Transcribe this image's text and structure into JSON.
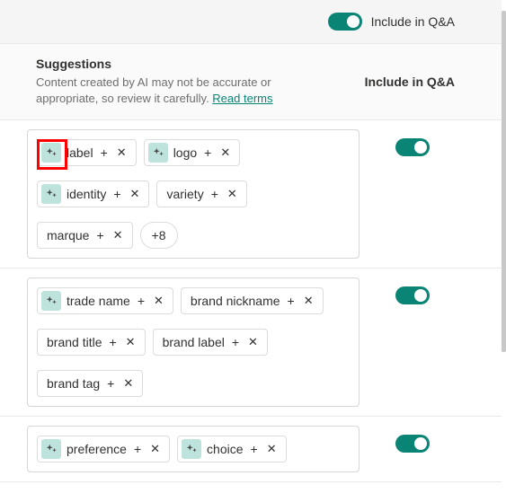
{
  "accent": "#0a8474",
  "topbar": {
    "toggle_label": "Include in Q&A",
    "toggle_on": true
  },
  "subheader": {
    "title": "Suggestions",
    "help_text_a": "Content created by AI may not be accurate or appropriate, so review it carefully. ",
    "link_text": "Read terms",
    "column_label": "Include in Q&A"
  },
  "groups": [
    {
      "toggle_on": true,
      "chips": [
        {
          "ai": true,
          "label": "label"
        },
        {
          "ai": true,
          "label": "logo"
        },
        {
          "ai": true,
          "label": "identity"
        },
        {
          "ai": false,
          "label": "variety"
        },
        {
          "ai": false,
          "label": "marque"
        }
      ],
      "more": "+8"
    },
    {
      "toggle_on": true,
      "chips": [
        {
          "ai": true,
          "label": "trade name"
        },
        {
          "ai": false,
          "label": "brand nickname"
        },
        {
          "ai": false,
          "label": "brand title"
        },
        {
          "ai": false,
          "label": "brand label"
        },
        {
          "ai": false,
          "label": "brand tag"
        }
      ],
      "more": null
    },
    {
      "toggle_on": true,
      "chips": [
        {
          "ai": true,
          "label": "preference"
        },
        {
          "ai": true,
          "label": "choice"
        }
      ],
      "more": null
    }
  ],
  "glyphs": {
    "plus": "+",
    "close": "✕"
  }
}
